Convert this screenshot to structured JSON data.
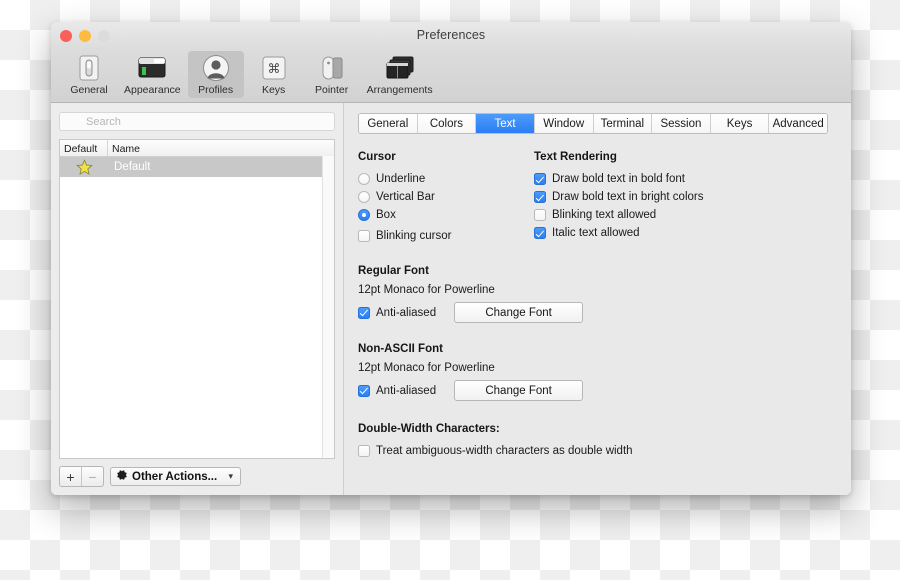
{
  "window": {
    "title": "Preferences",
    "traffic_lights": [
      "close",
      "minimize",
      "zoom"
    ]
  },
  "toolbar": {
    "items": [
      {
        "label": "General",
        "icon": "switch-icon",
        "selected": false
      },
      {
        "label": "Appearance",
        "icon": "window-icon",
        "selected": false
      },
      {
        "label": "Profiles",
        "icon": "person-icon",
        "selected": true
      },
      {
        "label": "Keys",
        "icon": "command-key-icon",
        "selected": false
      },
      {
        "label": "Pointer",
        "icon": "mouse-icon",
        "selected": false
      },
      {
        "label": "Arrangements",
        "icon": "windows-stack-icon",
        "selected": false
      }
    ]
  },
  "sidebar": {
    "search": {
      "placeholder": "Search",
      "value": ""
    },
    "columns": [
      "Default",
      "Name"
    ],
    "rows": [
      {
        "name": "Default",
        "is_default": true,
        "selected": true
      }
    ],
    "footer": {
      "add_label": "+",
      "remove_label": "−",
      "actions_label": "Other Actions...",
      "actions_icon": "gear-icon",
      "chevron_icon": "chevron-down-icon"
    }
  },
  "panel": {
    "tabs": [
      {
        "label": "General",
        "active": false
      },
      {
        "label": "Colors",
        "active": false
      },
      {
        "label": "Text",
        "active": true
      },
      {
        "label": "Window",
        "active": false
      },
      {
        "label": "Terminal",
        "active": false
      },
      {
        "label": "Session",
        "active": false
      },
      {
        "label": "Keys",
        "active": false
      },
      {
        "label": "Advanced",
        "active": false
      }
    ],
    "cursor": {
      "title": "Cursor",
      "options": [
        {
          "label": "Underline",
          "selected": false
        },
        {
          "label": "Vertical Bar",
          "selected": false
        },
        {
          "label": "Box",
          "selected": true
        }
      ],
      "blinking": {
        "label": "Blinking cursor",
        "checked": false
      }
    },
    "text_rendering": {
      "title": "Text Rendering",
      "options": [
        {
          "label": "Draw bold text in bold font",
          "checked": true
        },
        {
          "label": "Draw bold text in bright colors",
          "checked": true
        },
        {
          "label": "Blinking text allowed",
          "checked": false
        },
        {
          "label": "Italic text allowed",
          "checked": true
        }
      ]
    },
    "regular_font": {
      "title": "Regular Font",
      "font": "12pt Monaco for Powerline",
      "antialias": {
        "label": "Anti-aliased",
        "checked": true
      },
      "button": "Change Font"
    },
    "non_ascii_font": {
      "title": "Non-ASCII Font",
      "font": "12pt Monaco for Powerline",
      "antialias": {
        "label": "Anti-aliased",
        "checked": true
      },
      "button": "Change Font"
    },
    "double_width": {
      "title": "Double-Width Characters:",
      "option": {
        "label": "Treat ambiguous-width characters as double width",
        "checked": false
      }
    }
  },
  "colors": {
    "accent": "#2b7ef4",
    "window_bg": "#ececec",
    "panel_bg": "#e9e9e9",
    "star": "#f0e24a",
    "selected_row": "#c8c8c8"
  }
}
